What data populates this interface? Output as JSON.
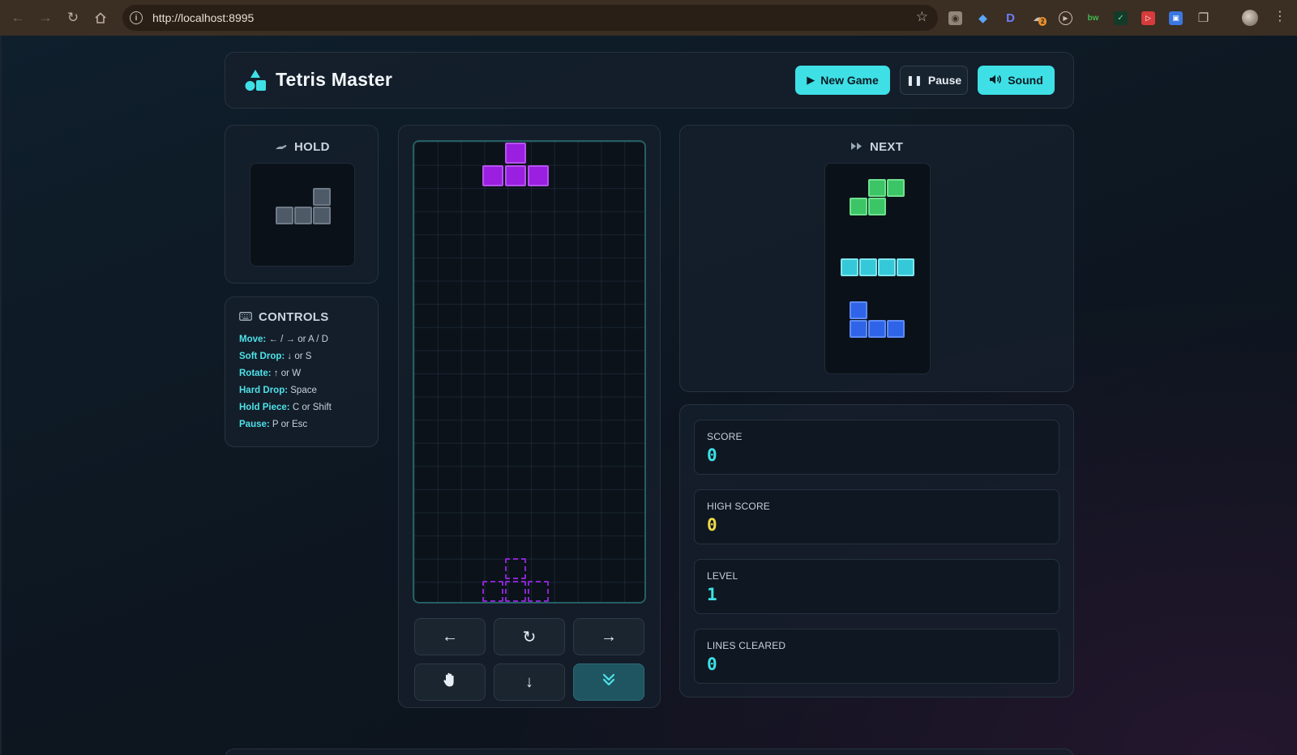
{
  "browser": {
    "url": "http://localhost:8995",
    "extension_badge": "2"
  },
  "header": {
    "title": "Tetris Master",
    "new_game_label": "New Game",
    "pause_label": "Pause",
    "sound_label": "Sound"
  },
  "hold": {
    "title": "HOLD",
    "piece": "L"
  },
  "controls": {
    "title": "CONTROLS",
    "items": [
      {
        "key": "Move:",
        "value": "← / → or A / D"
      },
      {
        "key": "Soft Drop:",
        "value": "↓ or S"
      },
      {
        "key": "Rotate:",
        "value": "↑ or W"
      },
      {
        "key": "Hard Drop:",
        "value": "Space"
      },
      {
        "key": "Hold Piece:",
        "value": "C or Shift"
      },
      {
        "key": "Pause:",
        "value": "P or Esc"
      }
    ]
  },
  "next": {
    "title": "NEXT",
    "pieces": [
      "S",
      "I",
      "J"
    ]
  },
  "board": {
    "columns": 10,
    "rows": 20,
    "active_piece": "T",
    "ghost_piece": "T"
  },
  "stats": [
    {
      "label": "SCORE",
      "value": "0"
    },
    {
      "label": "HIGH SCORE",
      "value": "0"
    },
    {
      "label": "LEVEL",
      "value": "1"
    },
    {
      "label": "LINES CLEARED",
      "value": "0"
    }
  ],
  "colors": {
    "accent": "#3ee0e6",
    "high_score": "#f0d94a",
    "t_piece": "#9b1fe0",
    "s_piece": "#3cc566",
    "i_piece": "#35c8d8",
    "j_piece": "#2f64e8",
    "hold_piece": "#4f5a68"
  }
}
